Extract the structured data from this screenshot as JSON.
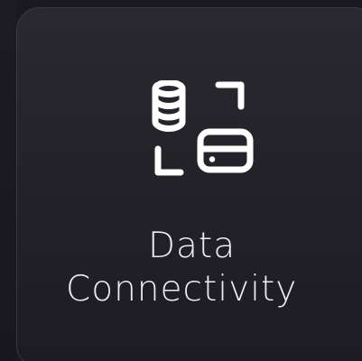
{
  "card": {
    "label_line1": "Data",
    "label_line2": "Connectivity",
    "icon": "database-connection-icon"
  },
  "colors": {
    "background": "#1a1920",
    "card_border": "#3a3942",
    "text": "#ecebef",
    "icon_stroke": "#ffffff"
  }
}
